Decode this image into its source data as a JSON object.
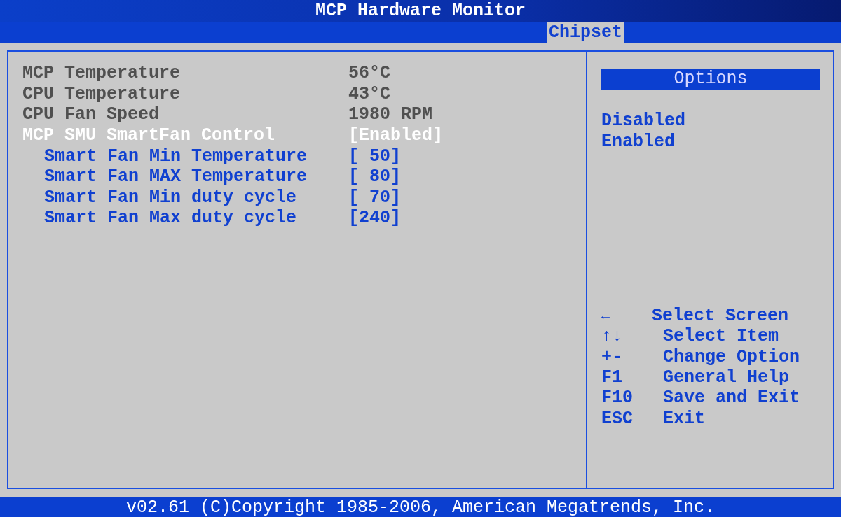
{
  "window": {
    "title": "MCP Hardware Monitor"
  },
  "tabs": [
    {
      "label": "Chipset",
      "selected": true
    }
  ],
  "settings": [
    {
      "label": "MCP Temperature",
      "value": "56°C",
      "kind": "info",
      "selected": false
    },
    {
      "label": "CPU Temperature",
      "value": "43°C",
      "kind": "info",
      "selected": false
    },
    {
      "label": "CPU Fan Speed",
      "value": "1980 RPM",
      "kind": "info",
      "selected": false
    },
    {
      "label": "MCP SMU SmartFan Control",
      "value": "[Enabled]",
      "kind": "option",
      "selected": true,
      "children": [
        {
          "label": "Smart Fan Min Temperature",
          "value": "[ 50]",
          "kind": "option",
          "selected": false
        },
        {
          "label": "Smart Fan MAX Temperature",
          "value": "[ 80]",
          "kind": "option",
          "selected": false
        },
        {
          "label": "Smart Fan Min duty cycle",
          "value": "[ 70]",
          "kind": "option",
          "selected": false
        },
        {
          "label": "Smart Fan Max duty cycle",
          "value": "[240]",
          "kind": "option",
          "selected": false
        }
      ]
    }
  ],
  "options_panel": {
    "title": "Options",
    "options": [
      "Disabled",
      "Enabled"
    ]
  },
  "key_help": [
    {
      "key": "←",
      "action": "Select Screen"
    },
    {
      "key": "↑↓",
      "action": "Select Item"
    },
    {
      "key": "+-",
      "action": "Change Option"
    },
    {
      "key": "F1",
      "action": "General Help"
    },
    {
      "key": "F10",
      "action": "Save and Exit"
    },
    {
      "key": "ESC",
      "action": "Exit"
    }
  ],
  "status_bar": "v02.61 (C)Copyright 1985-2006, American Megatrends, Inc."
}
